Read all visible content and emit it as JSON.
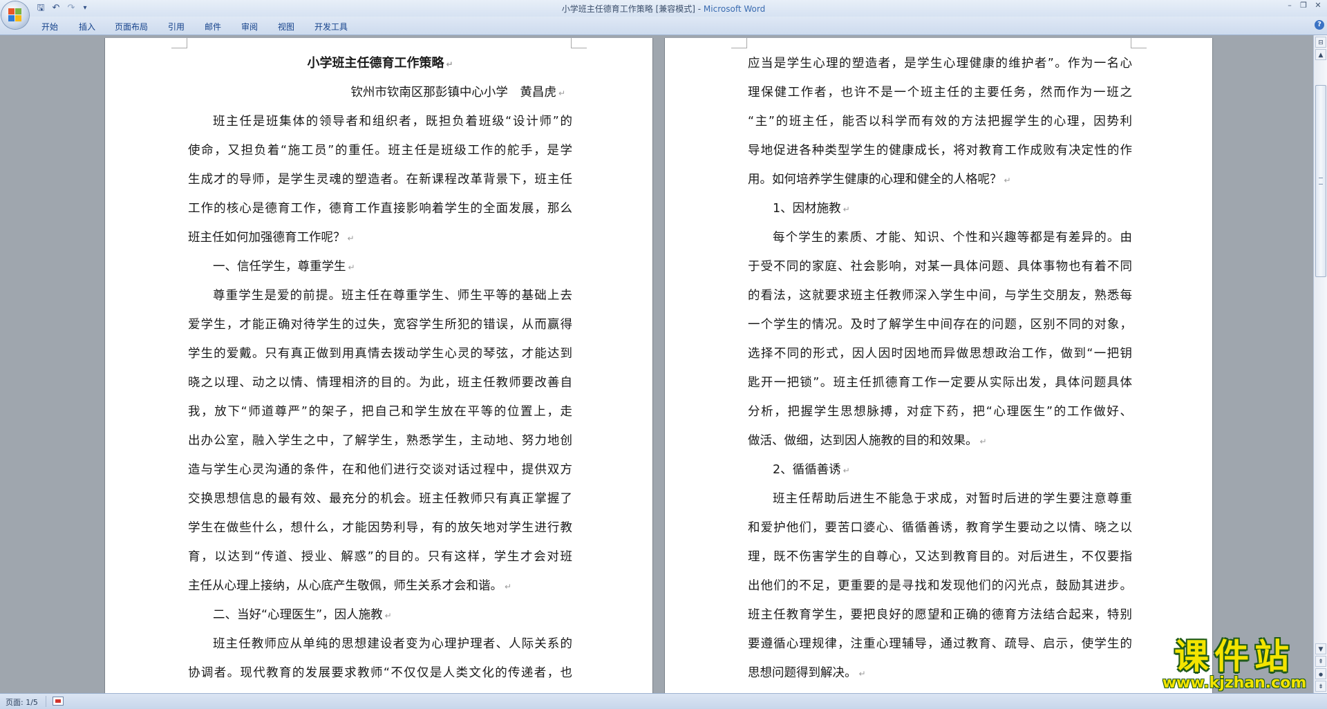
{
  "window": {
    "title_doc": "小学班主任德育工作策略 [兼容模式] - ",
    "title_app": "Microsoft Word",
    "controls": {
      "minimize": "–",
      "restore": "❐",
      "close": "✕"
    }
  },
  "quick_access": {
    "save": "🖫",
    "undo": "↶",
    "redo": "↷",
    "customize": "▾"
  },
  "ribbon_tabs": [
    "开始",
    "插入",
    "页面布局",
    "引用",
    "邮件",
    "审阅",
    "视图",
    "开发工具"
  ],
  "help": "?",
  "document": {
    "left_page": {
      "title": "小学班主任德育工作策略",
      "author": "钦州市钦南区那彭镇中心小学　黄昌虎",
      "lines": [
        "班主任是班集体的领导者和组织者，既担负着班级“设计师”的",
        "使命，又担负着“施工员”的重任。班主任是班级工作的舵手，是学",
        "生成才的导师，是学生灵魂的塑造者。在新课程改革背景下，班主任",
        "工作的核心是德育工作，德育工作直接影响着学生的全面发展，那么",
        "班主任如何加强德育工作呢？",
        "一、信任学生，尊重学生",
        "尊重学生是爱的前提。班主任在尊重学生、师生平等的基础上去",
        "爱学生，才能正确对待学生的过失，宽容学生所犯的错误，从而赢得",
        "学生的爱戴。只有真正做到用真情去拨动学生心灵的琴弦，才能达到",
        "晓之以理、动之以情、情理相济的目的。为此，班主任教师要改善自",
        "我，放下“师道尊严”的架子，把自己和学生放在平等的位置上，走",
        "出办公室，融入学生之中，了解学生，熟悉学生，主动地、努力地创",
        "造与学生心灵沟通的条件，在和他们进行交谈对话过程中，提供双方",
        "交换思想信息的最有效、最充分的机会。班主任教师只有真正掌握了",
        "学生在做些什么，想什么，才能因势利导，有的放矢地对学生进行教",
        "育，以达到“传道、授业、解惑”的目的。只有这样，学生才会对班",
        "主任从心理上接纳，从心底产生敬佩，师生关系才会和谐。",
        "二、当好“心理医生”，因人施教",
        "班主任教师应从单纯的思想建设者变为心理护理者、人际关系的",
        "协调者。现代教育的发展要求教师“不仅仅是人类文化的传递者，也"
      ]
    },
    "right_page": {
      "lines": [
        "应当是学生心理的塑造者，是学生心理健康的维护者”。作为一名心",
        "理保健工作者，也许不是一个班主任的主要任务，然而作为一班之",
        "“主”的班主任，能否以科学而有效的方法把握学生的心理，因势利",
        "导地促进各种类型学生的健康成长，将对教育工作成败有决定性的作",
        "用。如何培养学生健康的心理和健全的人格呢？",
        "1、因材施教",
        "每个学生的素质、才能、知识、个性和兴趣等都是有差异的。由",
        "于受不同的家庭、社会影响，对某一具体问题、具体事物也有着不同",
        "的看法，这就要求班主任教师深入学生中间，与学生交朋友，熟悉每",
        "一个学生的情况。及时了解学生中间存在的问题，区别不同的对象，",
        "选择不同的形式，因人因时因地而异做思想政治工作，做到“一把钥",
        "匙开一把锁”。班主任抓德育工作一定要从实际出发，具体问题具体",
        "分析，把握学生思想脉搏，对症下药，把“心理医生”的工作做好、",
        "做活、做细，达到因人施教的目的和效果。",
        "2、循循善诱",
        "班主任帮助后进生不能急于求成，对暂时后进的学生要注意尊重",
        "和爱护他们，要苦口婆心、循循善诱，教育学生要动之以情、晓之以",
        "理，既不伤害学生的自尊心，又达到教育目的。对后进生，不仅要指",
        "出他们的不足，更重要的是寻找和发现他们的闪光点，鼓励其进步。",
        "班主任教育学生，要把良好的愿望和正确的德育方法结合起来，特别",
        "要遵循心理规律，注重心理辅导，通过教育、疏导、启示，使学生的",
        "思想问题得到解决。"
      ]
    },
    "paragraph_mark": "↵"
  },
  "scrollbar": {
    "up": "▲",
    "down": "▼",
    "prev_page": "⇞",
    "select_browse": "●",
    "next_page": "⇟",
    "ruler_toggle": "⊟"
  },
  "status_bar": {
    "page": "页面: 1/5"
  },
  "watermark": {
    "title": "课件站",
    "url": "www.kjzhan.com"
  }
}
